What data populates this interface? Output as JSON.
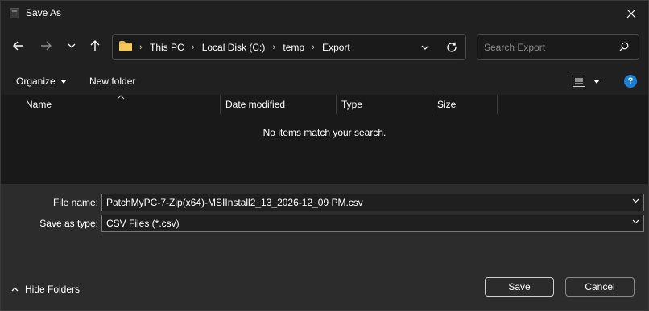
{
  "window": {
    "title": "Save As"
  },
  "nav": {
    "back_icon": "arrow-left-icon",
    "forward_icon": "arrow-right-icon",
    "recent_icon": "chevron-down-icon",
    "up_icon": "arrow-up-icon",
    "breadcrumbs": [
      "This PC",
      "Local Disk (C:)",
      "temp",
      "Export"
    ],
    "search_placeholder": "Search Export"
  },
  "commandbar": {
    "organize_label": "Organize",
    "new_folder_label": "New folder",
    "help_label": "?"
  },
  "filelist": {
    "columns": [
      "Name",
      "Date modified",
      "Type",
      "Size"
    ],
    "empty_message": "No items match your search."
  },
  "form": {
    "file_name_label": "File name:",
    "file_name_value": "PatchMyPC-7-Zip(x64)-MSIInstall2_13_2026-12_09 PM.csv",
    "save_as_type_label": "Save as type:",
    "save_as_type_value": "CSV Files (*.csv)"
  },
  "footer": {
    "hide_folders_label": "Hide Folders",
    "save_label": "Save",
    "cancel_label": "Cancel"
  },
  "colors": {
    "accent": "#1c7fd6",
    "folder": "#e8b94a",
    "background": "#202020",
    "panel": "#2c2c2c"
  }
}
